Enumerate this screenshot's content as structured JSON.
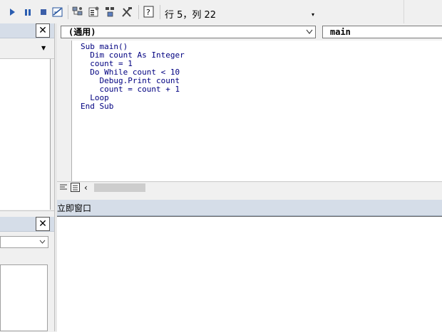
{
  "toolbar": {
    "status": "行 5，列 22",
    "dropdown_arrow": "▾",
    "icons": [
      "run-icon",
      "break-icon",
      "reset-icon",
      "design-mode-icon",
      "project-explorer-icon",
      "properties-icon",
      "object-browser-icon",
      "toolbox-icon",
      "help-icon"
    ]
  },
  "panes": {
    "project_close": "✕",
    "properties_close": "✕"
  },
  "code_window": {
    "object_combo": "(通用)",
    "procedure_combo": "main",
    "lines": [
      "Sub main()",
      "  Dim count As Integer",
      "  count = 1",
      "  Do While count < 10",
      "    Debug.Print count",
      "    count = count + 1",
      "  Loop",
      "End Sub"
    ]
  },
  "immediate_window": {
    "title": "立即窗口"
  },
  "colors": {
    "keyword": "#000080",
    "pane_header": "#d5dde8"
  }
}
